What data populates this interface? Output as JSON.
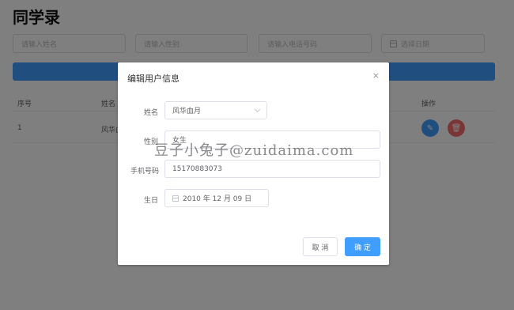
{
  "page": {
    "title": "同学录"
  },
  "filters": {
    "name_placeholder": "请输入姓名",
    "gender_placeholder": "请输入性别",
    "phone_placeholder": "请输入电话号码",
    "date_placeholder": "选择日期"
  },
  "table": {
    "headers": {
      "index": "序号",
      "name": "姓名",
      "actions": "操作"
    },
    "row": {
      "index": "1",
      "name": "风华血月"
    }
  },
  "dialog": {
    "title": "编辑用户信息",
    "close": "×",
    "fields": {
      "name_label": "姓名",
      "name_value": "风华血月",
      "gender_label": "性别",
      "gender_value": "女生",
      "phone_label": "手机号码",
      "phone_value": "15170883073",
      "birthday_label": "生日",
      "birthday_value": "2010 年 12 月 09 日"
    },
    "cancel_label": "取 消",
    "ok_label": "确 定"
  },
  "watermark": "豆子小兔子@zuidaima.com",
  "colors": {
    "primary": "#409eff",
    "danger": "#f56c6c",
    "overlay": "rgba(0,0,0,0.5)"
  }
}
